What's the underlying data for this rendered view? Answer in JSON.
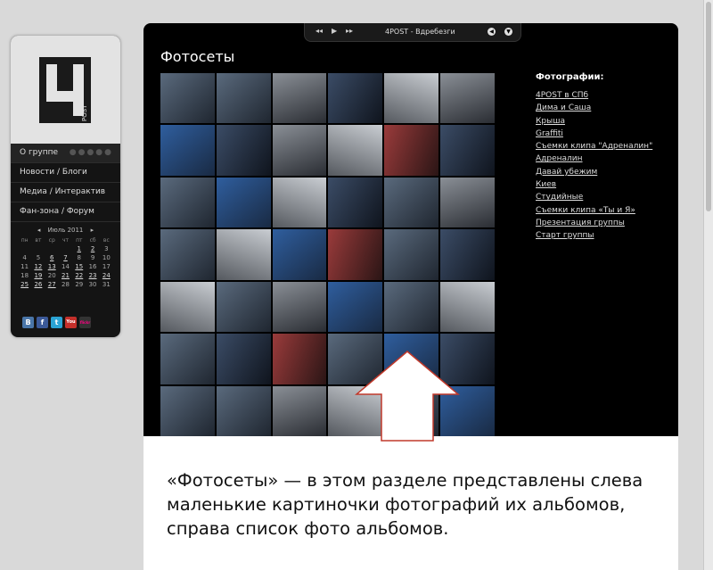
{
  "sidebar": {
    "logo_text": "4POST",
    "nav": [
      {
        "label": "О группе"
      },
      {
        "label": "Новости / Блоги"
      },
      {
        "label": "Медиа / Интерактив"
      },
      {
        "label": "Фан-зона / Форум"
      }
    ],
    "calendar": {
      "month": "Июль 2011",
      "weekdays": [
        "пн",
        "вт",
        "ср",
        "чт",
        "пт",
        "сб",
        "вс"
      ],
      "rows": [
        [
          "",
          "",
          "",
          "",
          "1",
          "2",
          "3"
        ],
        [
          "4",
          "5",
          "6",
          "7",
          "8",
          "9",
          "10"
        ],
        [
          "11",
          "12",
          "13",
          "14",
          "15",
          "16",
          "17"
        ],
        [
          "18",
          "19",
          "20",
          "21",
          "22",
          "23",
          "24"
        ],
        [
          "25",
          "26",
          "27",
          "28",
          "29",
          "30",
          "31"
        ]
      ]
    },
    "social": [
      "В",
      "f",
      "t",
      "You",
      "flickr"
    ]
  },
  "player": {
    "track": "4POST - Вдребезги"
  },
  "page": {
    "title": "Фотосеты"
  },
  "albums": {
    "heading": "Фотографии:",
    "items": [
      "4POST в СПб",
      "Дима и Саша",
      "Крыша",
      "Graffiti",
      "Съемки клипа \"Адреналин\"",
      "Адреналин",
      "Давай убежим",
      "Киев",
      "Студийные",
      "Съемки клипа «Ты и Я»",
      "Презентация группы",
      "Старт группы"
    ]
  },
  "caption": {
    "text": "«Фотосеты» — в этом разделе представлены слева маленькие картиночки фотографий их альбомов, справа список фото альбомов."
  },
  "colors": {
    "window_bg": "#000000",
    "page_bg": "#d9d9d9",
    "arrow_stroke": "#c0392b"
  }
}
